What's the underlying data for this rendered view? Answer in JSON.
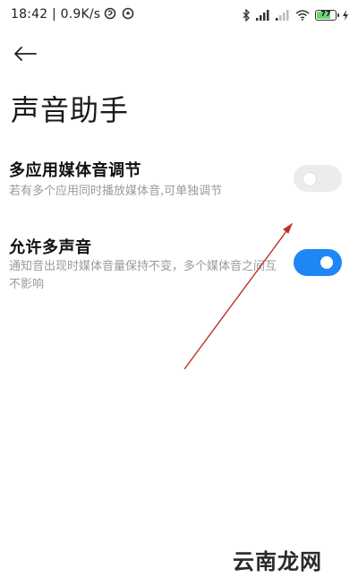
{
  "status_bar": {
    "time": "18:42",
    "net_speed": "0.9K/s",
    "battery_level": "77"
  },
  "header": {
    "title": "声音助手"
  },
  "settings": [
    {
      "title": "多应用媒体音调节",
      "description": "若有多个应用同时播放媒体音,可单独调节",
      "enabled": false
    },
    {
      "title": "允许多声音",
      "description": "通知音出现时媒体音量保持不变，多个媒体音之间互不影响",
      "enabled": true
    }
  ],
  "colors": {
    "accent": "#1f86f5",
    "arrow": "#c0302b"
  },
  "watermark": "云南龙网"
}
